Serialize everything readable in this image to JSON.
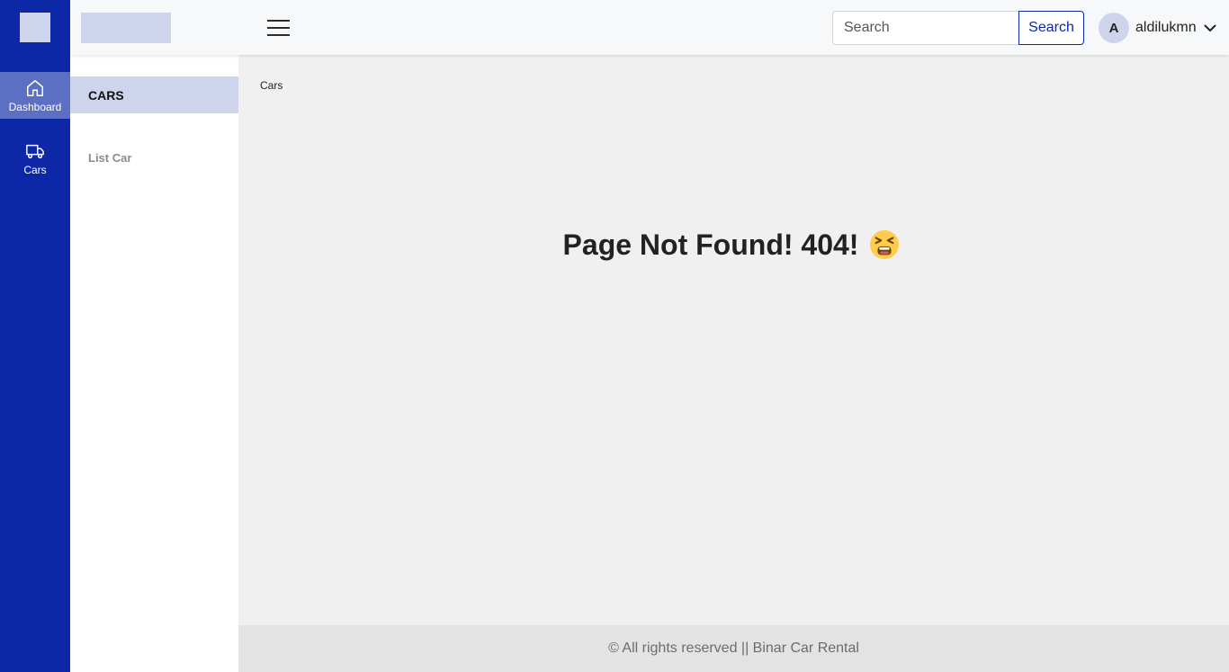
{
  "rail": {
    "items": [
      {
        "label": "Dashboard",
        "icon": "home-icon",
        "active": true
      },
      {
        "label": "Cars",
        "icon": "truck-icon",
        "active": false
      }
    ]
  },
  "header": {
    "search": {
      "placeholder": "Search",
      "button_label": "Search"
    },
    "user": {
      "initial": "A",
      "name": "aldilukmn"
    }
  },
  "subnav": {
    "title": "CARS",
    "items": [
      {
        "label": "List Car"
      }
    ]
  },
  "main": {
    "breadcrumb": "Cars",
    "message": "Page Not Found! 404!"
  },
  "footer": {
    "text": "© All rights reserved || Binar Car Rental"
  },
  "colors": {
    "primary": "#0d28a6",
    "rail_active": "#5c6fc2",
    "accent_light": "#cfd4ed",
    "page_bg": "#f0f0f0",
    "footer_bg": "#e3e3e3"
  }
}
